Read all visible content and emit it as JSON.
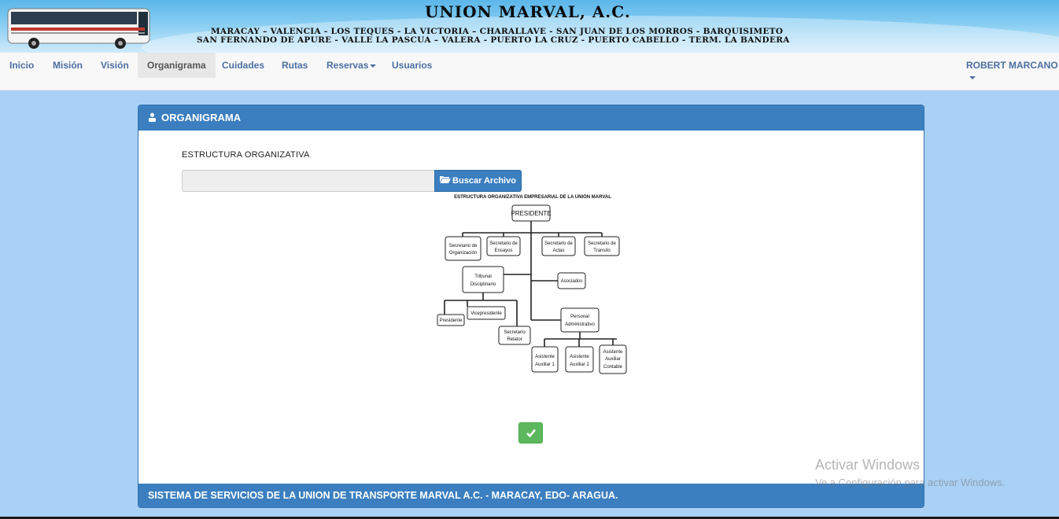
{
  "banner": {
    "title": "UNION MARVAL, A.C.",
    "routes_line1": "MARACAY – VALENCIA - LOS TEQUES - LA VICTORIA – CHARALLAVE - SAN JUAN DE LOS MORROS - BARQUISIMETO",
    "routes_line2": "SAN FERNANDO DE APURE - VALLE  LA PASCUA – VALERA - PUERTO LA CRUZ - PUERTO CABELLO - TERM. LA BANDERA"
  },
  "nav": {
    "items": [
      {
        "label": "Inicio"
      },
      {
        "label": "Misión"
      },
      {
        "label": "Visión"
      },
      {
        "label": "Organigrama"
      },
      {
        "label": "Cuidades"
      },
      {
        "label": "Rutas"
      },
      {
        "label": "Reservas"
      },
      {
        "label": "Usuarios"
      }
    ],
    "active": "Organigrama",
    "user": "ROBERT MARCANO"
  },
  "panel": {
    "title": "ORGANIGRAMA",
    "section_label": "ESTRUCTURA ORGANIZATIVA",
    "file_input_value": "",
    "browse_label": "Buscar Archivo",
    "footer": "SISTEMA DE SERVICIOS DE LA UNION DE TRANSPORTE MARVAL A.C. - MARACAY, EDO- ARAGUA."
  },
  "orgchart": {
    "title": "ESTRUCTURA ORGANIZATIVA EMPRESARIAL DE LA UNIÓN MARVAL",
    "president": "PRESIDENTE",
    "sec_org_1": "Secretario de",
    "sec_org_2": "Organización",
    "sec_ens_1": "Secretario de",
    "sec_ens_2": "Ensayos",
    "sec_act_1": "Secretario de",
    "sec_act_2": "Actas",
    "sec_tra_1": "Secretario de",
    "sec_tra_2": "Transito",
    "tribunal_1": "Tribunal",
    "tribunal_2": "Disciplinario",
    "asociados": "Asociados",
    "presidente": "Presidente",
    "vicepresidente": "Vicepresidente",
    "sec_rel_1": "Secretario",
    "sec_rel_2": "Relator",
    "personal_1": "Personal",
    "personal_2": "Administrativo",
    "asist1_1": "Asistente",
    "asist1_2": "Auxiliar 1",
    "asist2_1": "Asistente",
    "asist2_2": "Auxiliar 2",
    "asist3_1": "Asistente",
    "asist3_2": "Auxiliar",
    "asist3_3": "Contable"
  },
  "watermark": {
    "line1": "Activar Windows",
    "line2": "Ve a Configuración para activar Windows."
  },
  "colors": {
    "primary": "#3b7fc0",
    "success": "#5cb85c",
    "background": "#a9d1f5",
    "nav_link": "#4b6fa0"
  },
  "icons": {
    "panel_head": "user-tie-icon",
    "browse": "folder-open-icon",
    "ok": "check-icon",
    "dropdown": "caret-down-icon"
  }
}
